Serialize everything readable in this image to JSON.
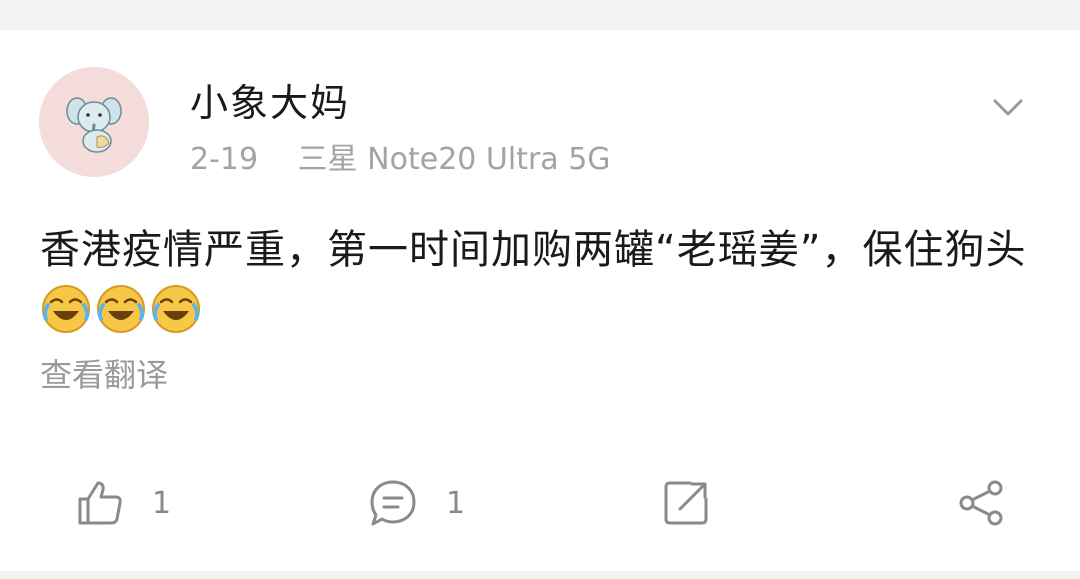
{
  "post": {
    "author": "小象大妈",
    "date": "2-19",
    "device": "三星 Note20 Ultra 5G",
    "text": "香港疫情严重，第一时间加购两罐“老瑶姜”，保住狗头",
    "emojis": [
      "laugh-cry-emoji",
      "laugh-cry-emoji",
      "laugh-cry-emoji"
    ],
    "translate_label": "查看翻译"
  },
  "actions": {
    "like_count": "1",
    "comment_count": "1"
  },
  "colors": {
    "page_bg": "#f2f2f2",
    "card_bg": "#ffffff",
    "text_primary": "#1a1a1a",
    "text_secondary": "#a3a3a3",
    "icon_gray": "#8a8a8a",
    "avatar_bg": "#f3dcd9"
  }
}
